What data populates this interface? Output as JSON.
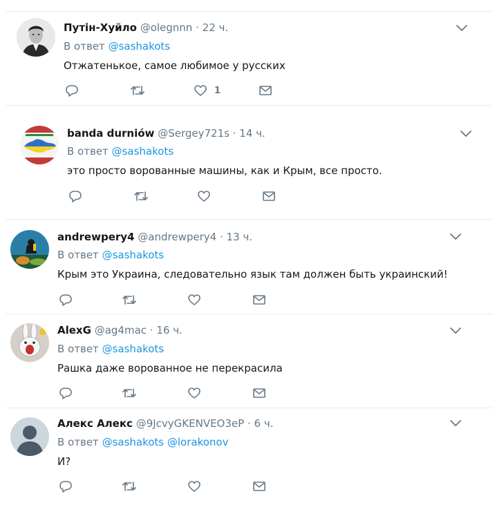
{
  "tweets": [
    {
      "name": "Путін-Хуйло",
      "handle": "@olegnnn",
      "dot": "·",
      "time": "22 ч.",
      "reply_label": "В ответ",
      "mentions": [
        "@sashakots"
      ],
      "text": "Отжатенькое, самое любимое у русских",
      "like_count": "1",
      "avatar": "portrait"
    },
    {
      "name": "banda durniów",
      "handle": "@Sergey721s",
      "dot": "·",
      "time": "14 ч.",
      "reply_label": "В ответ",
      "mentions": [
        "@sashakots"
      ],
      "text": "это просто ворованные машины, как и Крым, все просто.",
      "like_count": "",
      "avatar": "crimea-map"
    },
    {
      "name": "andrewpery4",
      "handle": "@andrewpery4",
      "dot": "·",
      "time": "13 ч.",
      "reply_label": "В ответ",
      "mentions": [
        "@sashakots"
      ],
      "text": "Крым это Украина, следовательно язык там должен быть украинский!",
      "like_count": "",
      "avatar": "diver"
    },
    {
      "name": "AlexG",
      "handle": "@ag4mac",
      "dot": "·",
      "time": "16 ч.",
      "reply_label": "В ответ",
      "mentions": [
        "@sashakots"
      ],
      "text": "Рашка даже ворованное не перекрасила",
      "like_count": "",
      "avatar": "rabbit"
    },
    {
      "name": "Алекс Алекс",
      "handle": "@9JcvyGKENVEO3eP",
      "dot": "·",
      "time": "6 ч.",
      "reply_label": "В ответ",
      "mentions": [
        "@sashakots",
        "@lorakonov"
      ],
      "text": "И?",
      "like_count": "",
      "avatar": "default-person"
    }
  ],
  "colors": {
    "link": "#1b95e0",
    "secondary": "#657786",
    "text": "#14171a",
    "divider": "#e6ecf0"
  },
  "icons": [
    "reply-icon",
    "retweet-icon",
    "like-icon",
    "direct-message-icon",
    "chevron-down-icon"
  ]
}
